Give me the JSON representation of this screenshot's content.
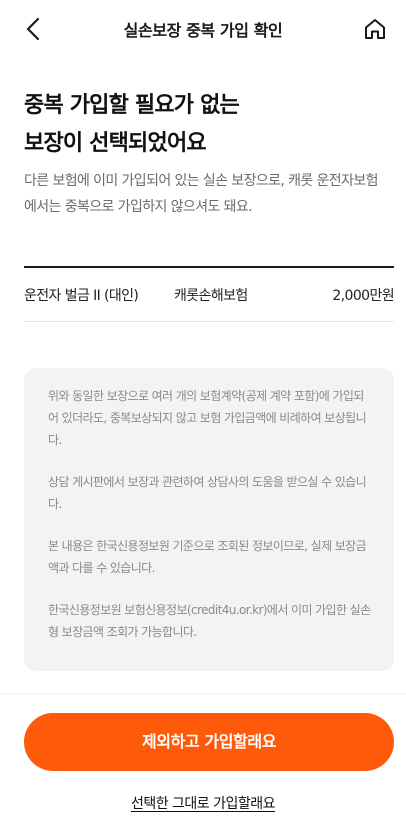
{
  "header": {
    "title": "실손보장 중복 가입 확인",
    "back_icon": "chevron-left-icon",
    "home_icon": "home-icon"
  },
  "headline": {
    "line1": "중복 가입할 필요가 없는",
    "line2": "보장이 선택되었어요"
  },
  "description": "다른 보험에 이미 가입되어 있는 실손 보장으로, 캐롯 운전자보험에서는 중복으로 가입하지 않으셔도 돼요.",
  "coverage": {
    "name": "운전자 벌금 II (대인)",
    "company": "캐롯손해보험",
    "amount": "2,000만원"
  },
  "notices": [
    "위와 동일한 보장으로 여러 개의 보험계약(공제 계약 포함)에 가입되어 있더라도, 중복보상되지 않고 보험 가입금액에 비례하여 보상됩니다.",
    "상담 게시판에서 보장과 관련하여 상담사의 도움을 받으실 수 있습니다.",
    "본 내용은 한국신용정보원 기준으로 조회된 정보이므로, 실제 보장금액과 다를 수 있습니다.",
    "한국신용정보원 보험신용정보(credit4u.or.kr)에서 이미 가입한 실손형 보장금액 조회가 가능합니다."
  ],
  "actions": {
    "primary_label": "제외하고 가입할래요",
    "secondary_label": "선택한 그대로 가입할래요"
  },
  "colors": {
    "accent": "#ff5a0a",
    "notice_bg": "#f3f3f3"
  }
}
